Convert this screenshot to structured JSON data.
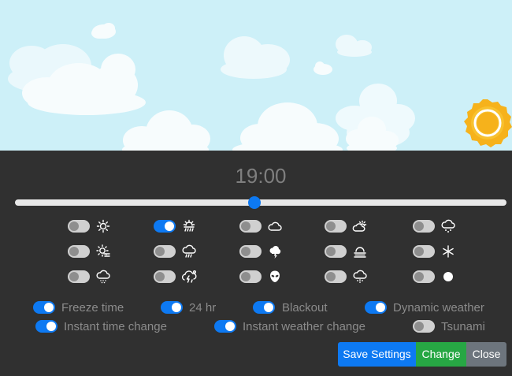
{
  "time_display": "19:00",
  "time_slider": {
    "value": 0.5
  },
  "weather_toggles": [
    {
      "icon": "sun-icon",
      "on": false
    },
    {
      "icon": "sun-rain-icon",
      "on": true
    },
    {
      "icon": "cloud-icon",
      "on": false
    },
    {
      "icon": "sun-cloud-icon",
      "on": false
    },
    {
      "icon": "cloud-hail-icon",
      "on": false
    },
    {
      "icon": "sun-haze-icon",
      "on": false
    },
    {
      "icon": "cloud-rain-icon",
      "on": false
    },
    {
      "icon": "thunder-cloud-icon",
      "on": false
    },
    {
      "icon": "fog-icon",
      "on": false
    },
    {
      "icon": "snowflake-icon",
      "on": false
    },
    {
      "icon": "cloud-drizzle-icon",
      "on": false
    },
    {
      "icon": "storm-cloud-icon",
      "on": false
    },
    {
      "icon": "alien-icon",
      "on": false
    },
    {
      "icon": "cloud-snow-icon",
      "on": false
    },
    {
      "icon": "moon-icon",
      "on": false
    }
  ],
  "options": {
    "freeze_time": {
      "label": "Freeze time",
      "on": true
    },
    "hr24": {
      "label": "24 hr",
      "on": true
    },
    "blackout": {
      "label": "Blackout",
      "on": true
    },
    "dynamic_weather": {
      "label": "Dynamic weather",
      "on": true
    },
    "instant_time_change": {
      "label": "Instant time change",
      "on": true
    },
    "instant_weather_change": {
      "label": "Instant weather change",
      "on": true
    },
    "tsunami": {
      "label": "Tsunami",
      "on": false
    }
  },
  "buttons": {
    "save": "Save Settings",
    "change": "Change",
    "close": "Close"
  },
  "colors": {
    "sky": "#cdf0f8",
    "panel": "#303030",
    "accent": "#0d79f2",
    "success": "#27a744",
    "secondary": "#6d757d",
    "sun": "#f6b21b"
  }
}
